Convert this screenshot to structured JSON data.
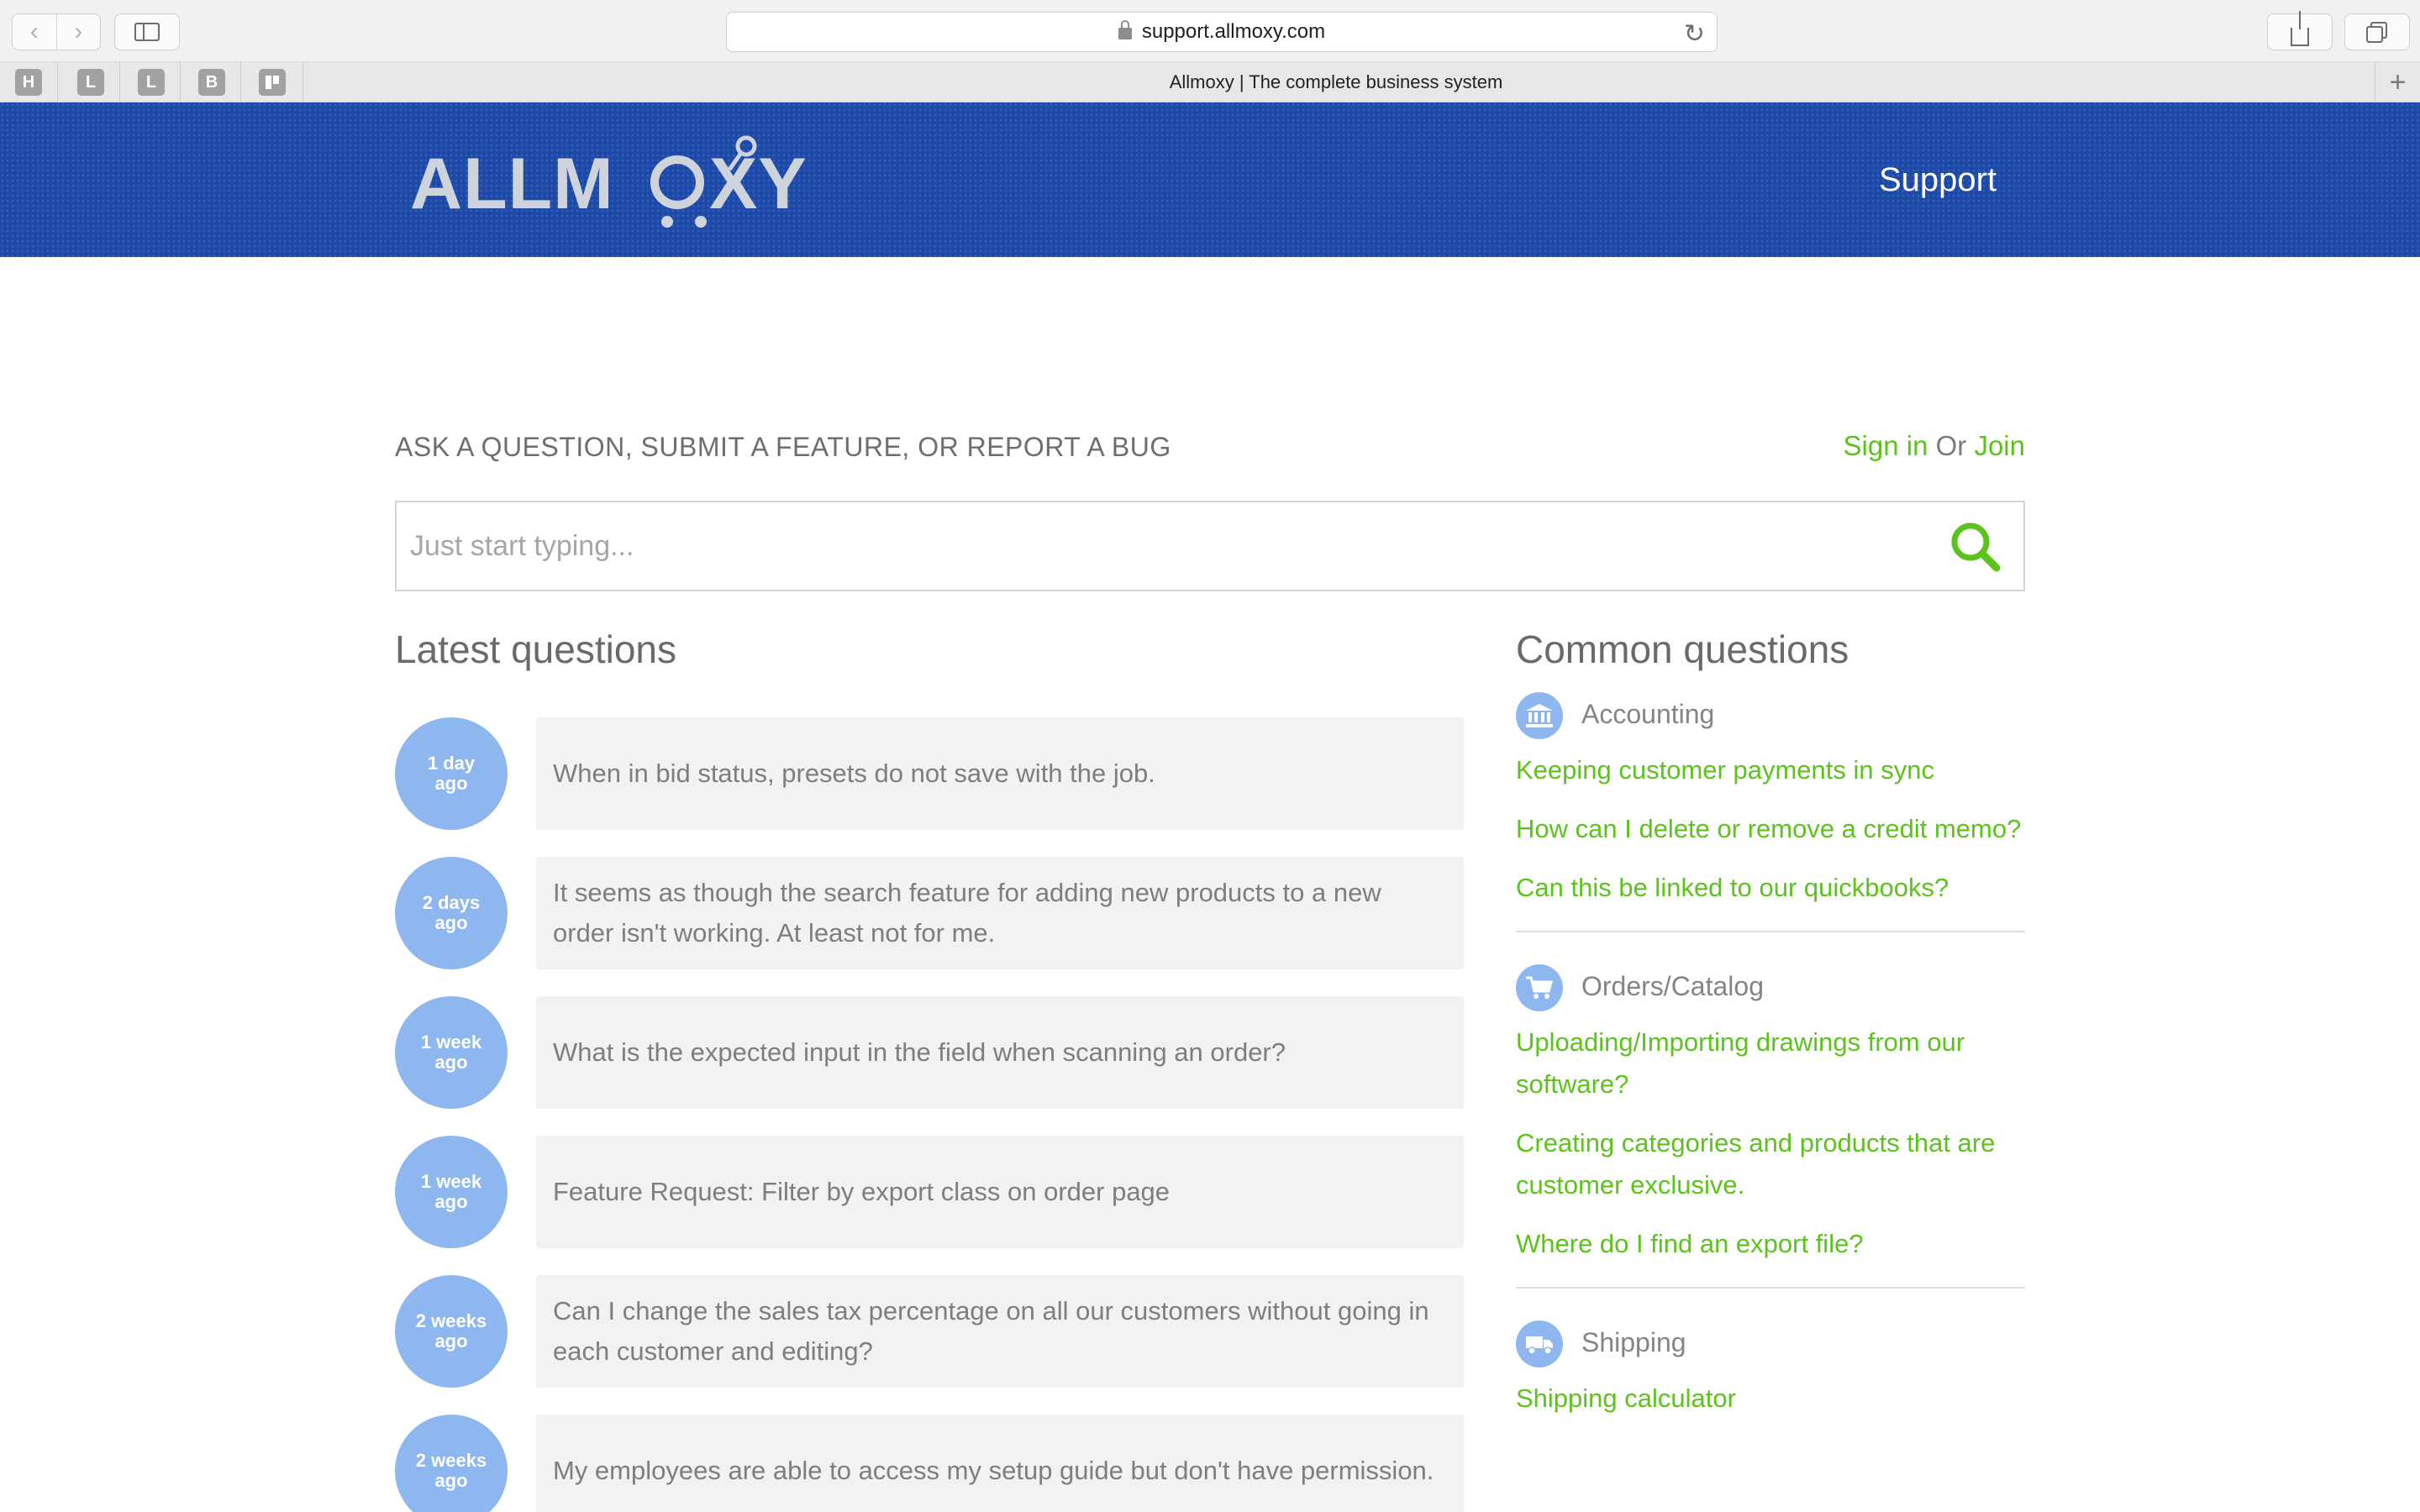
{
  "browser": {
    "url": "support.allmoxy.com",
    "tab_title": "Allmoxy | The complete business system",
    "bookmarks": [
      "H",
      "L",
      "L",
      "B",
      ""
    ]
  },
  "header": {
    "logo_text": "ALLMOXY",
    "support_label": "Support",
    "brand_color": "#1d4aa8"
  },
  "main": {
    "ask_label": "ASK A QUESTION, SUBMIT A FEATURE, OR REPORT A BUG",
    "sign_in": "Sign in",
    "or": "Or",
    "join": "Join",
    "search_placeholder": "Just start typing...",
    "accent_color": "#5cc31d"
  },
  "latest": {
    "title": "Latest questions",
    "items": [
      {
        "age_num": "1 day",
        "age_suffix": "ago",
        "text": "When in bid status, presets do not save with the job."
      },
      {
        "age_num": "2 days",
        "age_suffix": "ago",
        "text": "It seems as though the search feature for adding new products to a new order isn't working. At least not for me."
      },
      {
        "age_num": "1 week",
        "age_suffix": "ago",
        "text": "What is the expected input in the field when scanning an order?"
      },
      {
        "age_num": "1 week",
        "age_suffix": "ago",
        "text": "Feature Request: Filter by export class on order page"
      },
      {
        "age_num": "2 weeks",
        "age_suffix": "ago",
        "text": "Can I change the sales tax percentage on all our customers without going in each customer and editing?"
      },
      {
        "age_num": "2 weeks",
        "age_suffix": "ago",
        "text": "My employees are able to access my setup guide but don't have permission."
      }
    ]
  },
  "common": {
    "title": "Common questions",
    "categories": [
      {
        "label": "Accounting",
        "icon": "bank-icon",
        "questions": [
          "Keeping customer payments in sync",
          "How can I delete or remove a credit memo?",
          "Can this be linked to our quickbooks?"
        ]
      },
      {
        "label": "Orders/Catalog",
        "icon": "cart-icon",
        "questions": [
          "Uploading/Importing drawings from our software?",
          "Creating categories and products that are customer exclusive.",
          "Where do I find an export file?"
        ]
      },
      {
        "label": "Shipping",
        "icon": "truck-icon",
        "questions": [
          "Shipping calculator"
        ]
      }
    ]
  }
}
